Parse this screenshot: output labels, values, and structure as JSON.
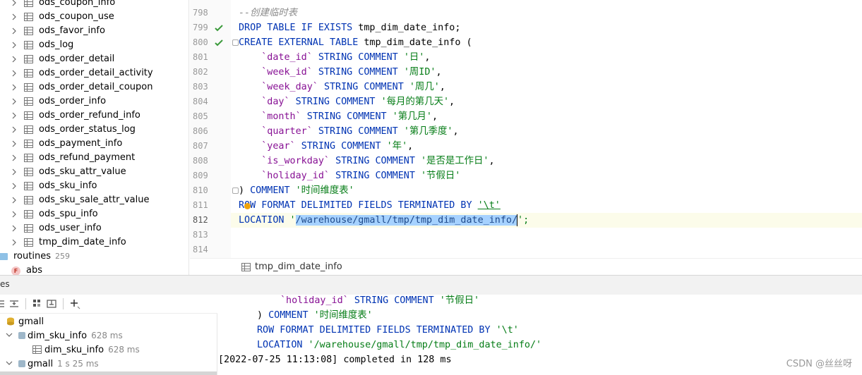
{
  "tree": {
    "items": [
      {
        "label": "ods_coupon_info"
      },
      {
        "label": "ods_coupon_use"
      },
      {
        "label": "ods_favor_info"
      },
      {
        "label": "ods_log"
      },
      {
        "label": "ods_order_detail"
      },
      {
        "label": "ods_order_detail_activity"
      },
      {
        "label": "ods_order_detail_coupon"
      },
      {
        "label": "ods_order_info"
      },
      {
        "label": "ods_order_refund_info"
      },
      {
        "label": "ods_order_status_log"
      },
      {
        "label": "ods_payment_info"
      },
      {
        "label": "ods_refund_payment"
      },
      {
        "label": "ods_sku_attr_value"
      },
      {
        "label": "ods_sku_info"
      },
      {
        "label": "ods_sku_sale_attr_value"
      },
      {
        "label": "ods_spu_info"
      },
      {
        "label": "ods_user_info"
      },
      {
        "label": "tmp_dim_date_info"
      }
    ],
    "routines_label": "routines",
    "routines_count": "259",
    "fn_icon": "F",
    "fn_label": "abs"
  },
  "editor": {
    "line_numbers": [
      "798",
      "799",
      "800",
      "801",
      "802",
      "803",
      "804",
      "805",
      "806",
      "807",
      "808",
      "809",
      "810",
      "811",
      "812",
      "813",
      "814"
    ],
    "comment_line": "--创建临时表",
    "l799": {
      "kw": "DROP TABLE IF EXISTS",
      "rest": " tmp_dim_date_info;"
    },
    "l800": {
      "kw": "CREATE EXTERNAL TABLE",
      "rest": " tmp_dim_date_info ("
    },
    "columns": [
      {
        "name": "`date_id`",
        "type": "STRING COMMENT",
        "comment": "'日'",
        "end": ","
      },
      {
        "name": "`week_id`",
        "type": "STRING COMMENT",
        "comment": "'周ID'",
        "end": ","
      },
      {
        "name": "`week_day`",
        "type": "STRING COMMENT",
        "comment": "'周几'",
        "end": ","
      },
      {
        "name": "`day`",
        "type": "STRING COMMENT",
        "comment": "'每月的第几天'",
        "end": ","
      },
      {
        "name": "`month`",
        "type": "STRING COMMENT",
        "comment": "'第几月'",
        "end": ","
      },
      {
        "name": "`quarter`",
        "type": "STRING COMMENT",
        "comment": "'第几季度'",
        "end": ","
      },
      {
        "name": "`year`",
        "type": "STRING COMMENT",
        "comment": "'年'",
        "end": ","
      },
      {
        "name": "`is_workday`",
        "type": "STRING COMMENT",
        "comment": "'是否是工作日'",
        "end": ","
      },
      {
        "name": "`holiday_id`",
        "type": "STRING COMMENT",
        "comment": "'节假日'",
        "end": ""
      }
    ],
    "l810": {
      "pre": ")",
      "kw": " COMMENT",
      "str": " '时间维度表'"
    },
    "l811": {
      "kw": "ROW FORMAT DELIMITED FIELDS TERMINATED BY",
      "str": "'\\t'"
    },
    "l812": {
      "kw": "LOCATION",
      "q1": " '",
      "sel": "/warehouse/gmall/tmp/tmp_dim_date_info/",
      "q2": "';"
    },
    "tab_label": "tmp_dim_date_info"
  },
  "panel": {
    "title_fragment": "es"
  },
  "services": {
    "root": "gmall",
    "items": [
      {
        "label": "dim_sku_info",
        "time": "628 ms"
      },
      {
        "label": "dim_sku_info",
        "time": "628 ms"
      },
      {
        "label": "gmall",
        "time": "1 s 25 ms"
      }
    ]
  },
  "output": {
    "l1": {
      "name": "`holiday_id`",
      "type": "STRING COMMENT",
      "comment": "'节假日'"
    },
    "l2": {
      "pre": ")",
      "kw": " COMMENT",
      "str": " '时间维度表'"
    },
    "l3": {
      "kw": "ROW FORMAT DELIMITED FIELDS TERMINATED BY",
      "str": " '\\t'"
    },
    "l4": {
      "kw": "LOCATION",
      "str": " '/warehouse/gmall/tmp/tmp_dim_date_info/'"
    },
    "status": "[2022-07-25 11:13:08] completed in 128 ms"
  },
  "watermark": "CSDN @丝丝呀",
  "colors": {
    "keyword": "#0033b3",
    "identifier": "#871094",
    "string": "#067d17",
    "selection": "#a6d2ff"
  }
}
